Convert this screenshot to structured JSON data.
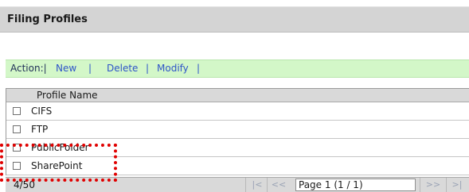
{
  "page": {
    "title": "Filing Profiles"
  },
  "actions": {
    "label": "Action:|",
    "sep": "|",
    "items": [
      {
        "label": "New"
      },
      {
        "label": "Delete"
      },
      {
        "label": "Modify"
      }
    ]
  },
  "table": {
    "header": "Profile Name",
    "rows": [
      {
        "name": "CIFS",
        "checked": false
      },
      {
        "name": "FTP",
        "checked": false
      },
      {
        "name": "PublicFolder",
        "checked": false
      },
      {
        "name": "SharePoint",
        "checked": false
      }
    ]
  },
  "footer": {
    "count": "4/50",
    "first": "|<",
    "prev": "<<",
    "page": "Page 1 (1 / 1)",
    "next": ">>",
    "last": ">|"
  },
  "colors": {
    "action_bar": "#d3f7c8",
    "link": "#2f55c8",
    "highlight": "#e00000"
  }
}
